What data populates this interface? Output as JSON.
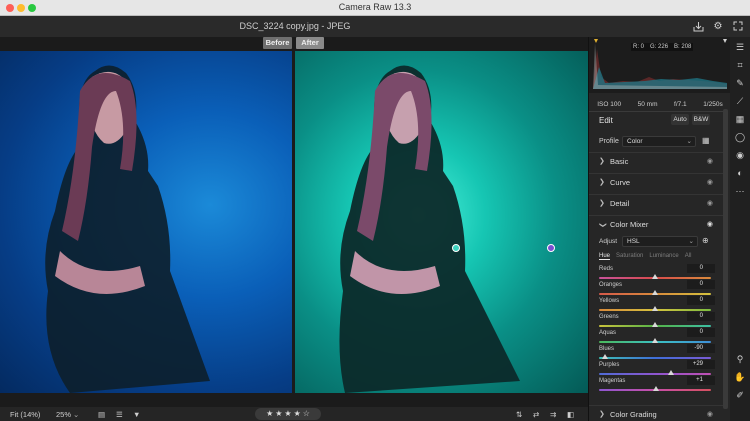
{
  "app": {
    "window_title": "Camera Raw 13.3"
  },
  "document": {
    "name": "DSC_3224 copy.jpg  -  JPEG"
  },
  "compare": {
    "before_label": "Before",
    "after_label": "After"
  },
  "status": {
    "fit": "Fit (14%)",
    "zoom": "25%",
    "stars": [
      "★",
      "★",
      "★",
      "★",
      "☆"
    ]
  },
  "histogram": {
    "r_label": "R: 0",
    "g_label": "G: 226",
    "b_label": "B: 208"
  },
  "exif": {
    "iso": "ISO 100",
    "focal": "50 mm",
    "aperture": "f/7.1",
    "shutter": "1/250s"
  },
  "edit": {
    "title": "Edit",
    "auto_label": "Auto",
    "bw_label": "B&W",
    "profile_label": "Profile",
    "profile_value": "Color"
  },
  "sections": {
    "basic": "Basic",
    "curve": "Curve",
    "detail": "Detail",
    "color_mixer": "Color Mixer",
    "color_grading": "Color Grading"
  },
  "mixer": {
    "adjust_label": "Adjust",
    "adjust_value": "HSL",
    "tabs": [
      "Hue",
      "Saturation",
      "Luminance",
      "All"
    ],
    "active_tab": "Hue",
    "sliders": [
      {
        "label": "Reds",
        "value": "0",
        "fraction": 0.5,
        "track": "linear-gradient(90deg,#c8529a,#d94b4b,#d98a3b)"
      },
      {
        "label": "Oranges",
        "value": "0",
        "fraction": 0.5,
        "track": "linear-gradient(90deg,#d65a4a,#d98a3b,#d5c23e)"
      },
      {
        "label": "Yellows",
        "value": "0",
        "fraction": 0.5,
        "track": "linear-gradient(90deg,#d98a3b,#d5c23e,#7dbd3f)"
      },
      {
        "label": "Greens",
        "value": "0",
        "fraction": 0.5,
        "track": "linear-gradient(90deg,#c9c33c,#55b347,#3cbfa3)"
      },
      {
        "label": "Aquas",
        "value": "0",
        "fraction": 0.5,
        "track": "linear-gradient(90deg,#4bb85b,#3cc1c1,#3f8fd8)"
      },
      {
        "label": "Blues",
        "value": "-90",
        "fraction": 0.05,
        "track": "linear-gradient(90deg,#3cc1b5,#3f6ed8,#7a5bd6)"
      },
      {
        "label": "Purples",
        "value": "+29",
        "fraction": 0.645,
        "track": "linear-gradient(90deg,#4f6bd6,#8e56d0,#c04fb3)"
      },
      {
        "label": "Magentas",
        "value": "+1",
        "fraction": 0.505,
        "track": "linear-gradient(90deg,#8e56d0,#c84fa8,#d65060)"
      }
    ]
  },
  "icons": {
    "top": [
      "save-icon",
      "gear-icon",
      "fullscreen-icon"
    ],
    "tools": [
      "edit-sliders-icon",
      "crop-icon",
      "healing-icon",
      "mask-brush-icon",
      "gradient-icon",
      "radial-icon",
      "redeye-icon",
      "presets-icon",
      "more-icon",
      "zoom-icon",
      "hand-icon",
      "color-sampler-icon"
    ]
  }
}
